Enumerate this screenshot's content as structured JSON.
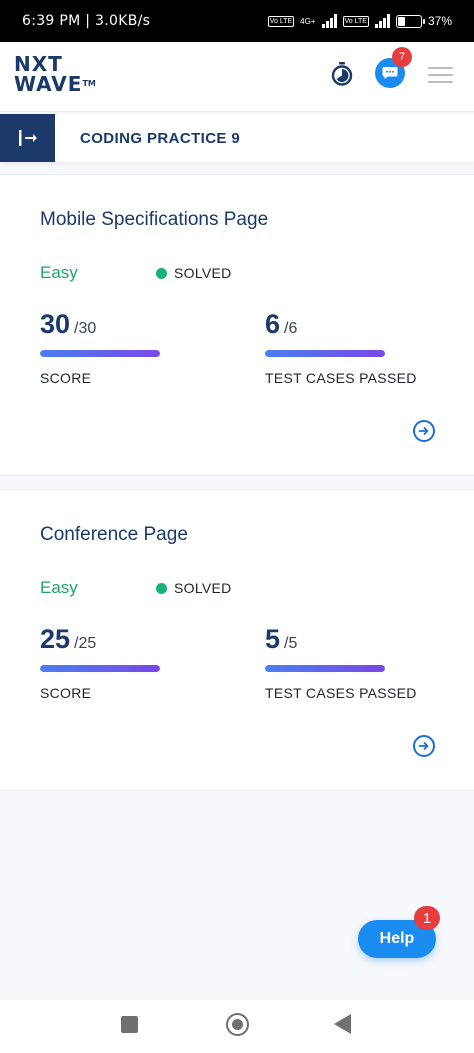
{
  "status_bar": {
    "time": "6:39 PM",
    "speed": "3.0KB/s",
    "network_1": "4G+",
    "volte": "Vo LTE",
    "battery": "37%",
    "battery_level": 0.37
  },
  "header": {
    "logo_line1": "NXT",
    "logo_line2": "WAVE",
    "logo_tm": "TM",
    "chat_badge": "7",
    "accent": "#1a8cf0",
    "brand": "#1b3a6b"
  },
  "sub_header": {
    "title": "CODING PRACTICE 9"
  },
  "cards": [
    {
      "title": "Mobile Specifications Page",
      "difficulty": "Easy",
      "status": "SOLVED",
      "score": "30",
      "score_total": "/30",
      "score_fraction": 1.0,
      "score_label": "SCORE",
      "tests": "6",
      "tests_total": "/6",
      "tests_fraction": 1.0,
      "tests_label": "TEST CASES PASSED"
    },
    {
      "title": "Conference Page",
      "difficulty": "Easy",
      "status": "SOLVED",
      "score": "25",
      "score_total": "/25",
      "score_fraction": 1.0,
      "score_label": "SCORE",
      "tests": "5",
      "tests_total": "/5",
      "tests_fraction": 1.0,
      "tests_label": "TEST CASES PASSED"
    }
  ],
  "help": {
    "label": "Help",
    "badge": "1"
  },
  "icons": [
    "stopwatch-icon",
    "chat-icon",
    "hamburger-menu-icon",
    "sidebar-collapse-icon",
    "arrow-right-circle-icon",
    "recent-apps-icon",
    "home-icon",
    "back-icon"
  ]
}
